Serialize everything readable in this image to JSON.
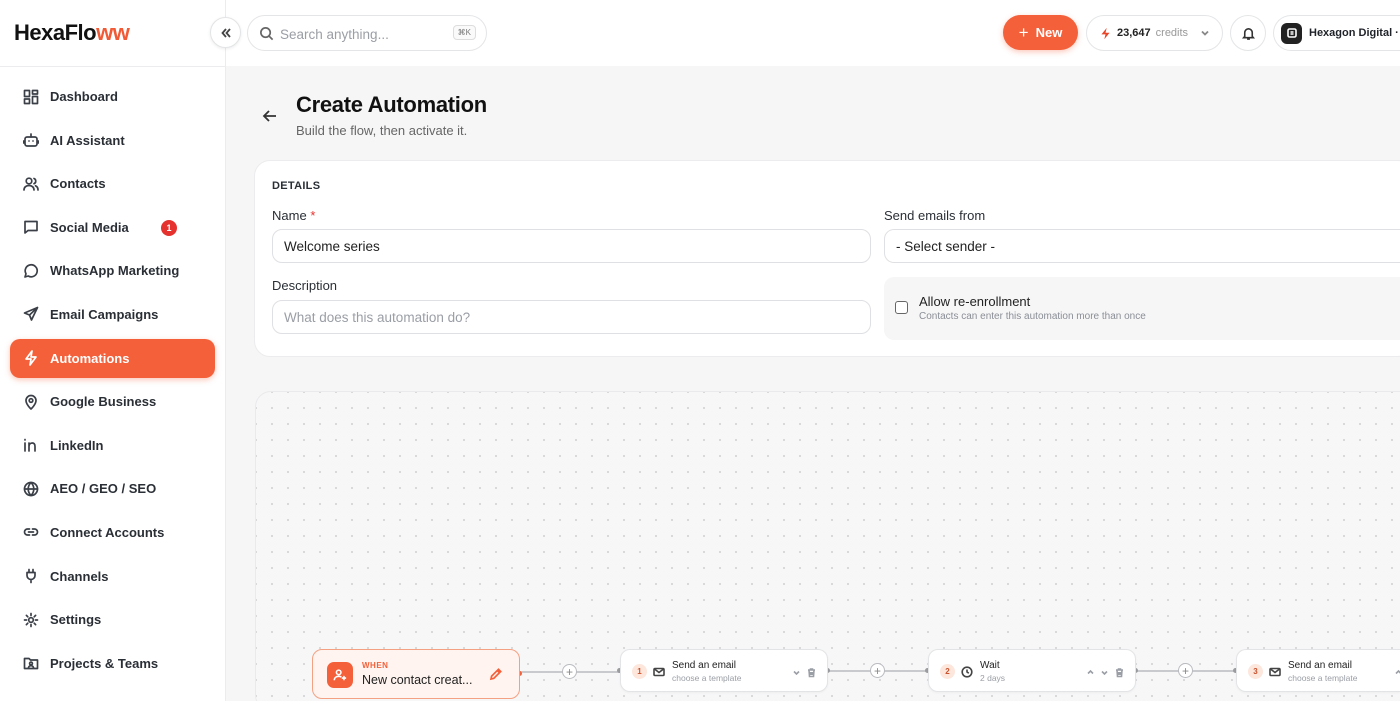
{
  "brand": {
    "logo_main": "HexaFlo",
    "logo_accent": "ww"
  },
  "colors": {
    "accent": "#f4603a",
    "badge": "#e5322f"
  },
  "sidebar": {
    "items": [
      {
        "label": "Dashboard",
        "icon": "dashboard-icon"
      },
      {
        "label": "AI Assistant",
        "icon": "robot-icon"
      },
      {
        "label": "Contacts",
        "icon": "users-icon"
      },
      {
        "label": "Social Media",
        "icon": "chat-square-icon",
        "badge": "1"
      },
      {
        "label": "WhatsApp Marketing",
        "icon": "whatsapp-icon"
      },
      {
        "label": "Email Campaigns",
        "icon": "send-icon"
      },
      {
        "label": "Automations",
        "icon": "bolt-icon",
        "active": true
      },
      {
        "label": "Google Business",
        "icon": "map-pin-icon"
      },
      {
        "label": "LinkedIn",
        "icon": "linkedin-icon"
      },
      {
        "label": "AEO / GEO / SEO",
        "icon": "globe-icon"
      },
      {
        "label": "Connect Accounts",
        "icon": "link-icon"
      },
      {
        "label": "Channels",
        "icon": "plug-icon"
      },
      {
        "label": "Settings",
        "icon": "gear-icon"
      },
      {
        "label": "Projects & Teams",
        "icon": "folder-users-icon"
      }
    ]
  },
  "topbar": {
    "search_placeholder": "Search anything...",
    "search_shortcut": "⌘K",
    "new_label": "New",
    "credits_value": "23,647",
    "credits_label": "credits",
    "account_name": "Hexagon Digital · D"
  },
  "page": {
    "title": "Create Automation",
    "subtitle": "Build the flow, then activate it."
  },
  "details": {
    "section_label": "DETAILS",
    "name_label": "Name",
    "name_required": "*",
    "name_value": "Welcome series",
    "description_label": "Description",
    "description_placeholder": "What does this automation do?",
    "sender_label": "Send emails from",
    "sender_value": "- Select sender -",
    "reenroll_title": "Allow re-enrollment",
    "reenroll_sub": "Contacts can enter this automation more than once",
    "reenroll_checked": false
  },
  "flow": {
    "trigger": {
      "when_label": "WHEN",
      "name": "New contact creat..."
    },
    "steps": [
      {
        "number": "1",
        "title": "Send an email",
        "subtitle": "choose a template",
        "icon": "mail-icon"
      },
      {
        "number": "2",
        "title": "Wait",
        "subtitle": "2 days",
        "icon": "clock-icon"
      },
      {
        "number": "3",
        "title": "Send an email",
        "subtitle": "choose a template",
        "icon": "mail-icon"
      }
    ]
  }
}
